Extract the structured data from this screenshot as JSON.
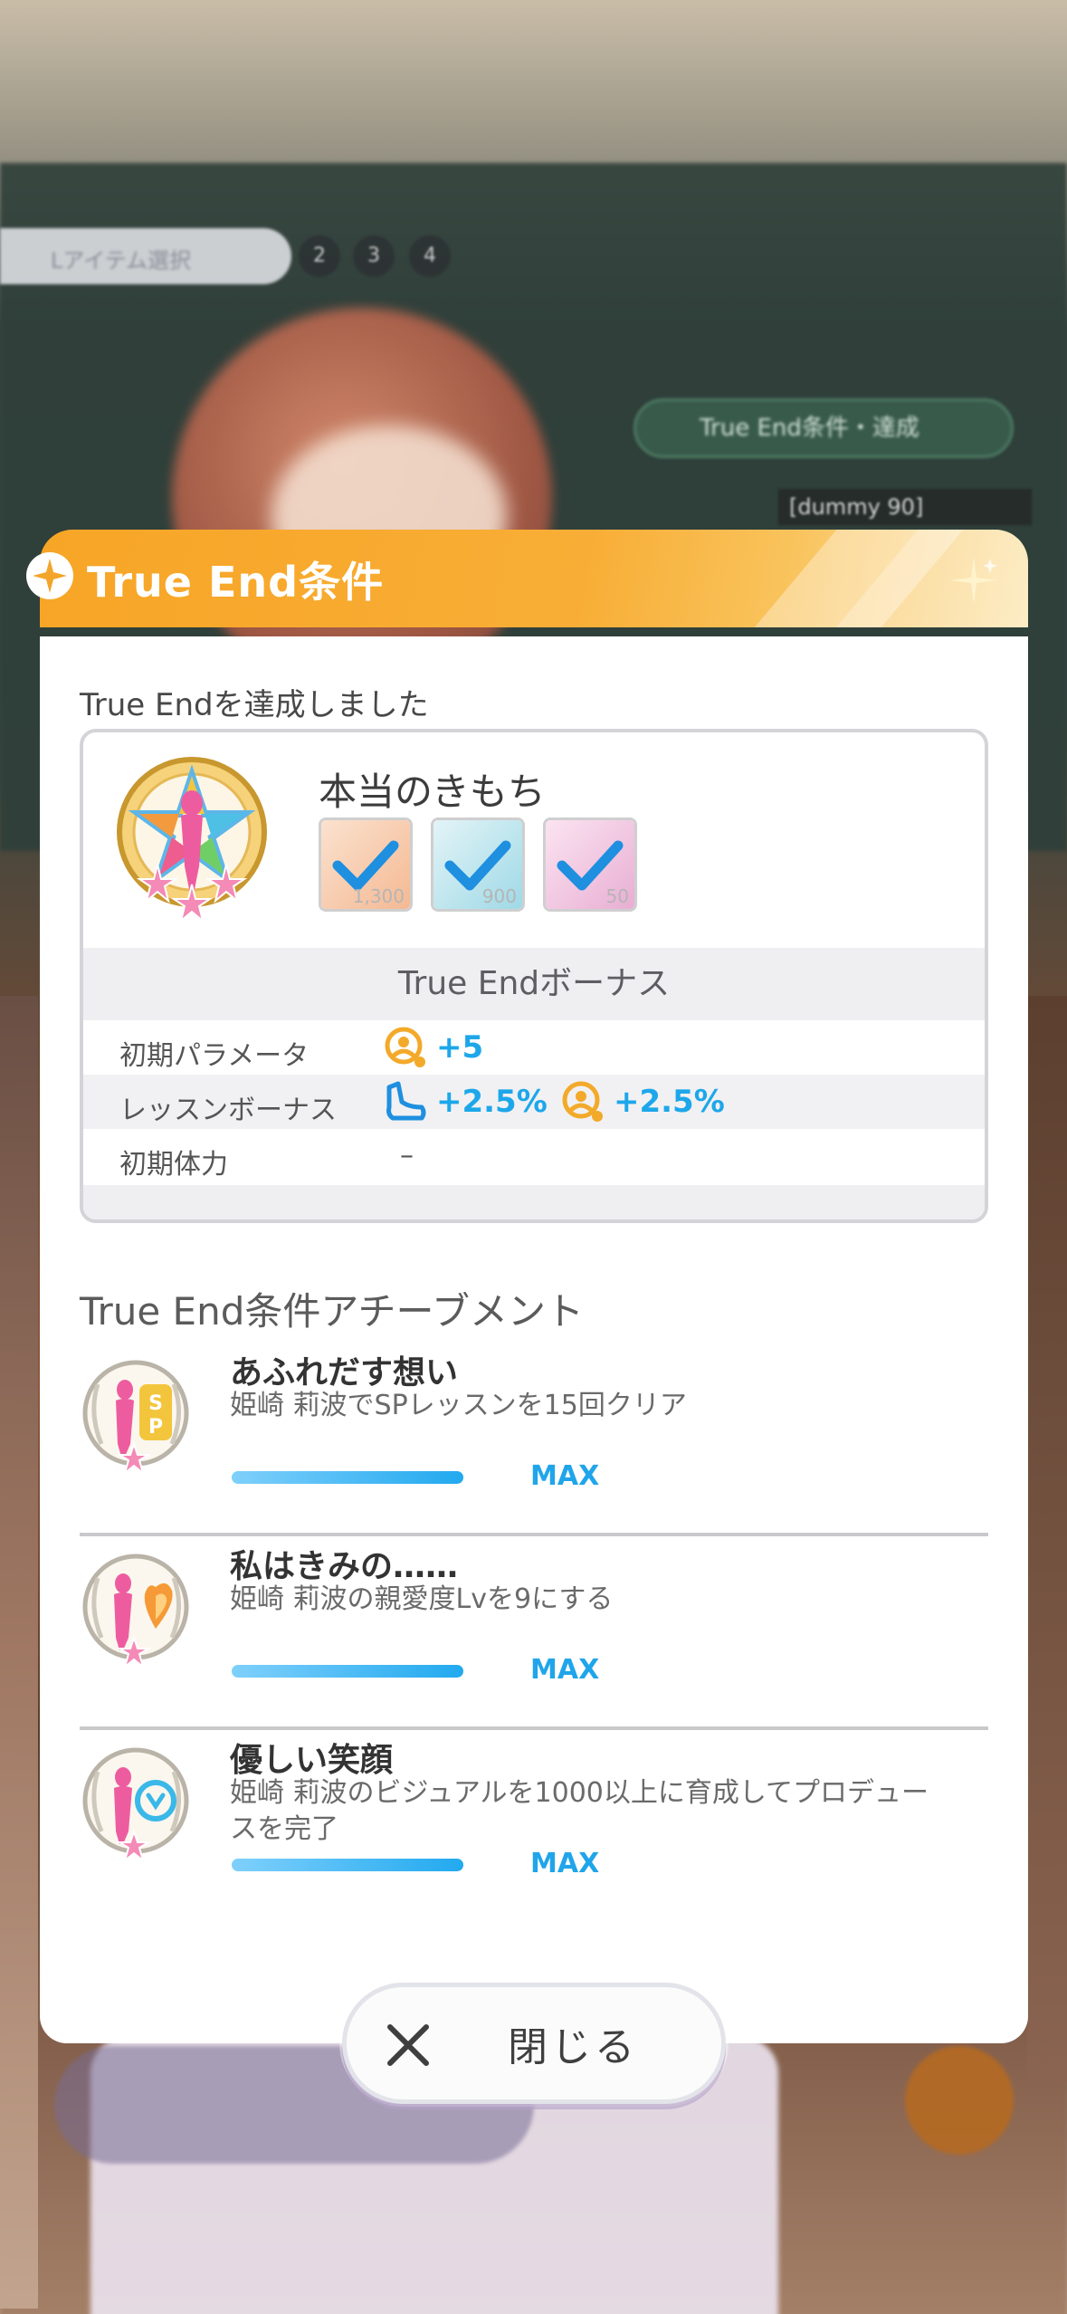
{
  "background": {
    "step_label": "Lアイテム選択",
    "steps": [
      "2",
      "3",
      "4"
    ],
    "true_end_chip": "True End条件・達成",
    "dummy_tag": "[dummy 90]"
  },
  "modal": {
    "title": "True End条件",
    "achieved_label": "True Endを達成しました",
    "reward": {
      "name": "本当のきもち",
      "items": [
        {
          "icon": "lesson-ticket-icon",
          "qty": "1,300",
          "color": "#f8d2b8"
        },
        {
          "icon": "pt-coin-icon",
          "qty": "900",
          "color": "#bfe6ee"
        },
        {
          "icon": "note-book-icon",
          "qty": "50",
          "color": "#f2c9e1"
        }
      ]
    },
    "bonus": {
      "header": "True Endボーナス",
      "rows": [
        {
          "label": "初期パラメータ",
          "values": [
            {
              "icon": "all-params-icon",
              "text": "+5"
            }
          ]
        },
        {
          "label": "レッスンボーナス",
          "values": [
            {
              "icon": "dance-shoe-icon",
              "text": "+2.5%"
            },
            {
              "icon": "all-params-icon",
              "text": "+2.5%"
            }
          ]
        },
        {
          "label": "初期体力",
          "dash": "–"
        }
      ]
    },
    "achievements_title": "True End条件アチーブメント",
    "achievements": [
      {
        "name": "あふれだす想い",
        "desc": "姫崎 莉波でSPレッスンを15回クリア",
        "status": "MAX",
        "progress": 1.0,
        "badge": "SP"
      },
      {
        "name": "私はきみの……",
        "desc": "姫崎 莉波の親愛度Lvを9にする",
        "status": "MAX",
        "progress": 1.0,
        "badge": "heart"
      },
      {
        "name": "優しい笑顔",
        "desc": "姫崎 莉波のビジュアルを1000以上に育成してプロデュースを完了",
        "status": "MAX",
        "progress": 1.0,
        "badge": "visual"
      }
    ],
    "close_label": "閉じる"
  },
  "colors": {
    "header_orange": "#f7a526",
    "accent_blue": "#1da7ea",
    "pink": "#ee5ca0"
  }
}
